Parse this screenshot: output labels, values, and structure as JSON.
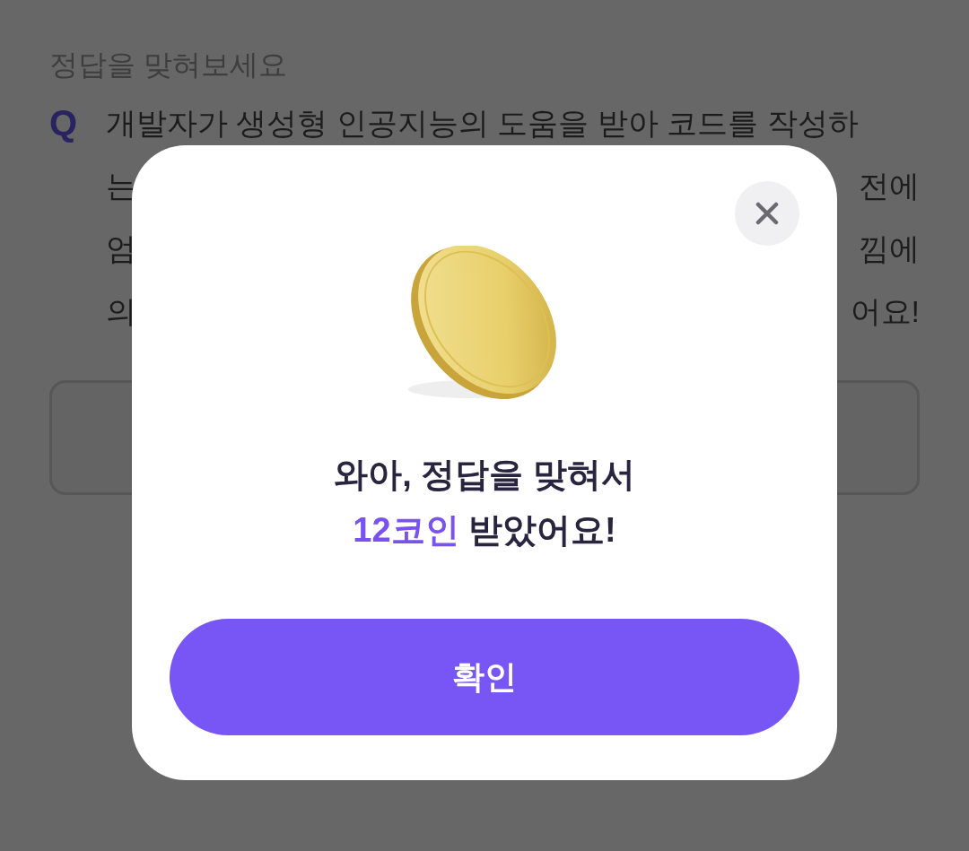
{
  "page": {
    "title": "정답을 맞혀보세요",
    "question_mark": "Q",
    "question_lines": [
      {
        "left": "개발자가 생성형 인공지능의 도움을 받아 코드를 작성하"
      },
      {
        "left": "는",
        "right": "전에"
      },
      {
        "left": "엄",
        "right": "낌에"
      },
      {
        "left": "의",
        "right": "어요!"
      }
    ]
  },
  "dialog": {
    "line_1": "와아, 정답을 맞혀서",
    "highlight": "12코인",
    "line_2_rest": " 받았어요!",
    "confirm_button": "확인"
  }
}
